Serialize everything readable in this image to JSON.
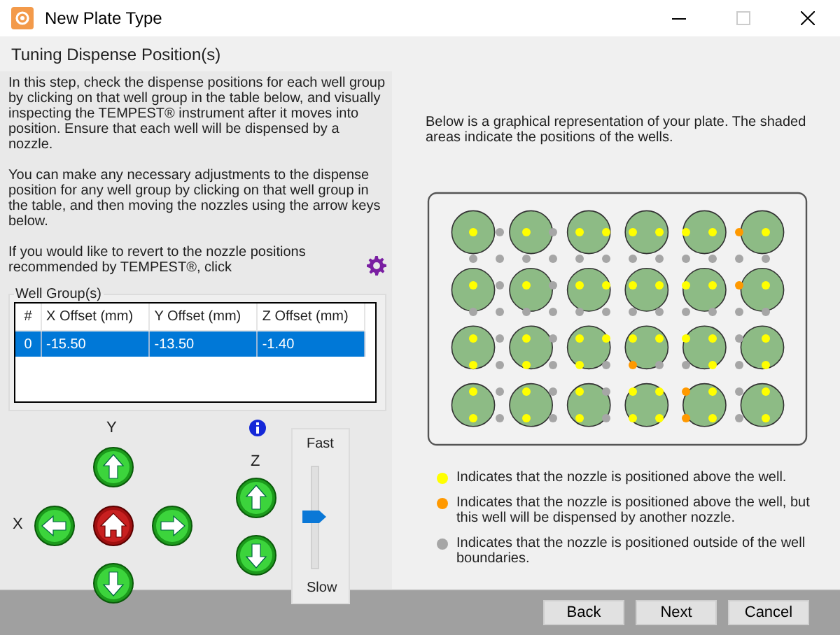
{
  "window": {
    "title": "New Plate Type"
  },
  "heading": "Tuning Dispense Position(s)",
  "instructions": [
    "In this step, check the dispense positions for each well group by clicking on that well group in the table below, and visually inspecting the TEMPEST® instrument after it moves into position. Ensure that each well will be dispensed by a nozzle.",
    "You can make any necessary adjustments to the dispense position for any well group by clicking on that well group in the table, and then moving the nozzles using the arrow keys below."
  ],
  "revert_note": "If you would like to revert to the nozzle positions recommended by TEMPEST®, click",
  "well_groups": {
    "label": "Well Group(s)",
    "columns": [
      "#",
      "X Offset (mm)",
      "Y Offset (mm)",
      "Z Offset (mm)"
    ],
    "rows": [
      {
        "cells": [
          "0",
          "-15.50",
          "-13.50",
          "-1.40"
        ],
        "selected": true
      }
    ]
  },
  "axes": {
    "y_label": "Y",
    "x_label": "X",
    "z_label": "Z"
  },
  "speed": {
    "fast_label": "Fast",
    "slow_label": "Slow",
    "level": 0.5
  },
  "plate": {
    "description": "Below is a graphical representation of your plate. The shaded areas indicate the positions of the wells.",
    "nozzle_rows": [
      [
        {
          "color": "#ffff00"
        },
        {
          "color": "#a6a6a6"
        },
        {
          "color": "#ffff00"
        },
        {
          "color": "#a6a6a6"
        },
        {
          "color": "#ffff00"
        },
        {
          "color": "#ffff00"
        },
        {
          "color": "#ffff00"
        },
        {
          "color": "#ffff00"
        },
        {
          "color": "#ffff00"
        },
        {
          "color": "#ffff00"
        },
        {
          "color": "#ff9900"
        },
        {
          "color": "#ffff00"
        }
      ],
      [
        {
          "color": "#a6a6a6"
        },
        {
          "color": "#a6a6a6"
        },
        {
          "color": "#a6a6a6"
        },
        {
          "color": "#a6a6a6"
        },
        {
          "color": "#a6a6a6"
        },
        {
          "color": "#a6a6a6"
        },
        {
          "color": "#a6a6a6"
        },
        {
          "color": "#a6a6a6"
        },
        {
          "color": "#a6a6a6"
        },
        {
          "color": "#a6a6a6"
        },
        {
          "color": "#a6a6a6"
        },
        {
          "color": "#a6a6a6"
        }
      ],
      [
        {
          "color": "#ffff00"
        },
        {
          "color": "#a6a6a6"
        },
        {
          "color": "#ffff00"
        },
        {
          "color": "#a6a6a6"
        },
        {
          "color": "#ffff00"
        },
        {
          "color": "#ffff00"
        },
        {
          "color": "#ffff00"
        },
        {
          "color": "#ffff00"
        },
        {
          "color": "#ffff00"
        },
        {
          "color": "#ffff00"
        },
        {
          "color": "#ff9900"
        },
        {
          "color": "#ffff00"
        }
      ],
      [
        {
          "color": "#a6a6a6"
        },
        {
          "color": "#a6a6a6"
        },
        {
          "color": "#a6a6a6"
        },
        {
          "color": "#a6a6a6"
        },
        {
          "color": "#a6a6a6"
        },
        {
          "color": "#a6a6a6"
        },
        {
          "color": "#a6a6a6"
        },
        {
          "color": "#a6a6a6"
        },
        {
          "color": "#a6a6a6"
        },
        {
          "color": "#a6a6a6"
        },
        {
          "color": "#a6a6a6"
        },
        {
          "color": "#a6a6a6"
        }
      ],
      [
        {
          "color": "#ffff00"
        },
        {
          "color": "#a6a6a6"
        },
        {
          "color": "#ffff00"
        },
        {
          "color": "#a6a6a6"
        },
        {
          "color": "#ffff00"
        },
        {
          "color": "#ffff00"
        },
        {
          "color": "#ffff00"
        },
        {
          "color": "#ffff00"
        },
        {
          "color": "#ffff00"
        },
        {
          "color": "#ffff00"
        },
        {
          "color": "#a6a6a6"
        },
        {
          "color": "#ffff00"
        }
      ],
      [
        {
          "color": "#ffff00"
        },
        {
          "color": "#a6a6a6"
        },
        {
          "color": "#ffff00"
        },
        {
          "color": "#a6a6a6"
        },
        {
          "color": "#ffff00"
        },
        {
          "color": "#a6a6a6"
        },
        {
          "color": "#ff9900"
        },
        {
          "color": "#a6a6a6"
        },
        {
          "color": "#a6a6a6"
        },
        {
          "color": "#ffff00"
        },
        {
          "color": "#a6a6a6"
        },
        {
          "color": "#ffff00"
        }
      ],
      [
        {
          "color": "#ffff00"
        },
        {
          "color": "#a6a6a6"
        },
        {
          "color": "#ffff00"
        },
        {
          "color": "#a6a6a6"
        },
        {
          "color": "#ffff00"
        },
        {
          "color": "#a6a6a6"
        },
        {
          "color": "#ffff00"
        },
        {
          "color": "#ffff00"
        },
        {
          "color": "#ff9900"
        },
        {
          "color": "#ffff00"
        },
        {
          "color": "#a6a6a6"
        },
        {
          "color": "#ffff00"
        }
      ],
      [
        {
          "color": "#ffff00"
        },
        {
          "color": "#a6a6a6"
        },
        {
          "color": "#ffff00"
        },
        {
          "color": "#a6a6a6"
        },
        {
          "color": "#ffff00"
        },
        {
          "color": "#a6a6a6"
        },
        {
          "color": "#ffff00"
        },
        {
          "color": "#ffff00"
        },
        {
          "color": "#ff9900"
        },
        {
          "color": "#ffff00"
        },
        {
          "color": "#a6a6a6"
        },
        {
          "color": "#ffff00"
        }
      ]
    ]
  },
  "legend": [
    {
      "color": "#ffff00",
      "text": "Indicates that the nozzle is positioned above the well."
    },
    {
      "color": "#ff9900",
      "text": "Indicates that the nozzle is positioned above the well, but this well will be dispensed by another nozzle."
    },
    {
      "color": "#a6a6a6",
      "text": "Indicates that the nozzle is positioned outside of the well boundaries."
    }
  ],
  "buttons": [
    {
      "label": "Back"
    },
    {
      "label": "Next"
    },
    {
      "label": "Cancel"
    }
  ]
}
